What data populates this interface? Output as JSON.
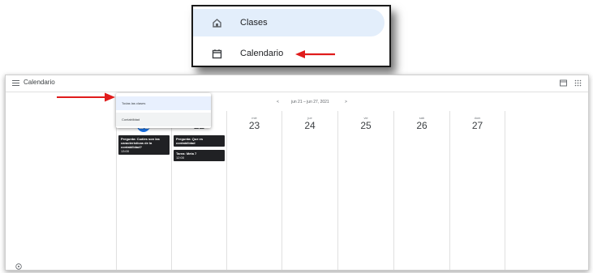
{
  "inset": {
    "items": [
      {
        "label": "Clases",
        "icon": "home-class-icon",
        "active": true
      },
      {
        "label": "Calendario",
        "icon": "calendar-icon",
        "active": false
      }
    ]
  },
  "app": {
    "title": "Calendario",
    "toolbar_icons": [
      "calendar-view-icon",
      "apps-grid-icon"
    ],
    "date_range": "jun 21 – jun 27, 2021"
  },
  "dropdown": {
    "options": [
      "Todas las clases",
      "Contabilidad"
    ],
    "selected": "Todas las clases"
  },
  "days": [
    {
      "name": "lun",
      "number": "21",
      "today": true
    },
    {
      "name": "mar",
      "number": "22",
      "today": false
    },
    {
      "name": "mié",
      "number": "23",
      "today": false
    },
    {
      "name": "jue",
      "number": "24",
      "today": false
    },
    {
      "name": "vie",
      "number": "25",
      "today": false
    },
    {
      "name": "sáb",
      "number": "26",
      "today": false
    },
    {
      "name": "dom",
      "number": "27",
      "today": false
    }
  ],
  "events": [
    {
      "day": "21",
      "title": "Pregunta: Cuáles son las características de la contabilidad?",
      "time": "13:00"
    },
    {
      "day": "22",
      "title": "Pregunta: Que es contabilidad",
      "time": ""
    },
    {
      "day": "22",
      "title": "Tarea: Meta 7",
      "time": "12:00"
    }
  ],
  "colors": {
    "accent": "#1a73e8",
    "event_bg": "#202124",
    "active_nav_bg": "#e3eefb",
    "annotation_arrow": "#e01b1b"
  }
}
